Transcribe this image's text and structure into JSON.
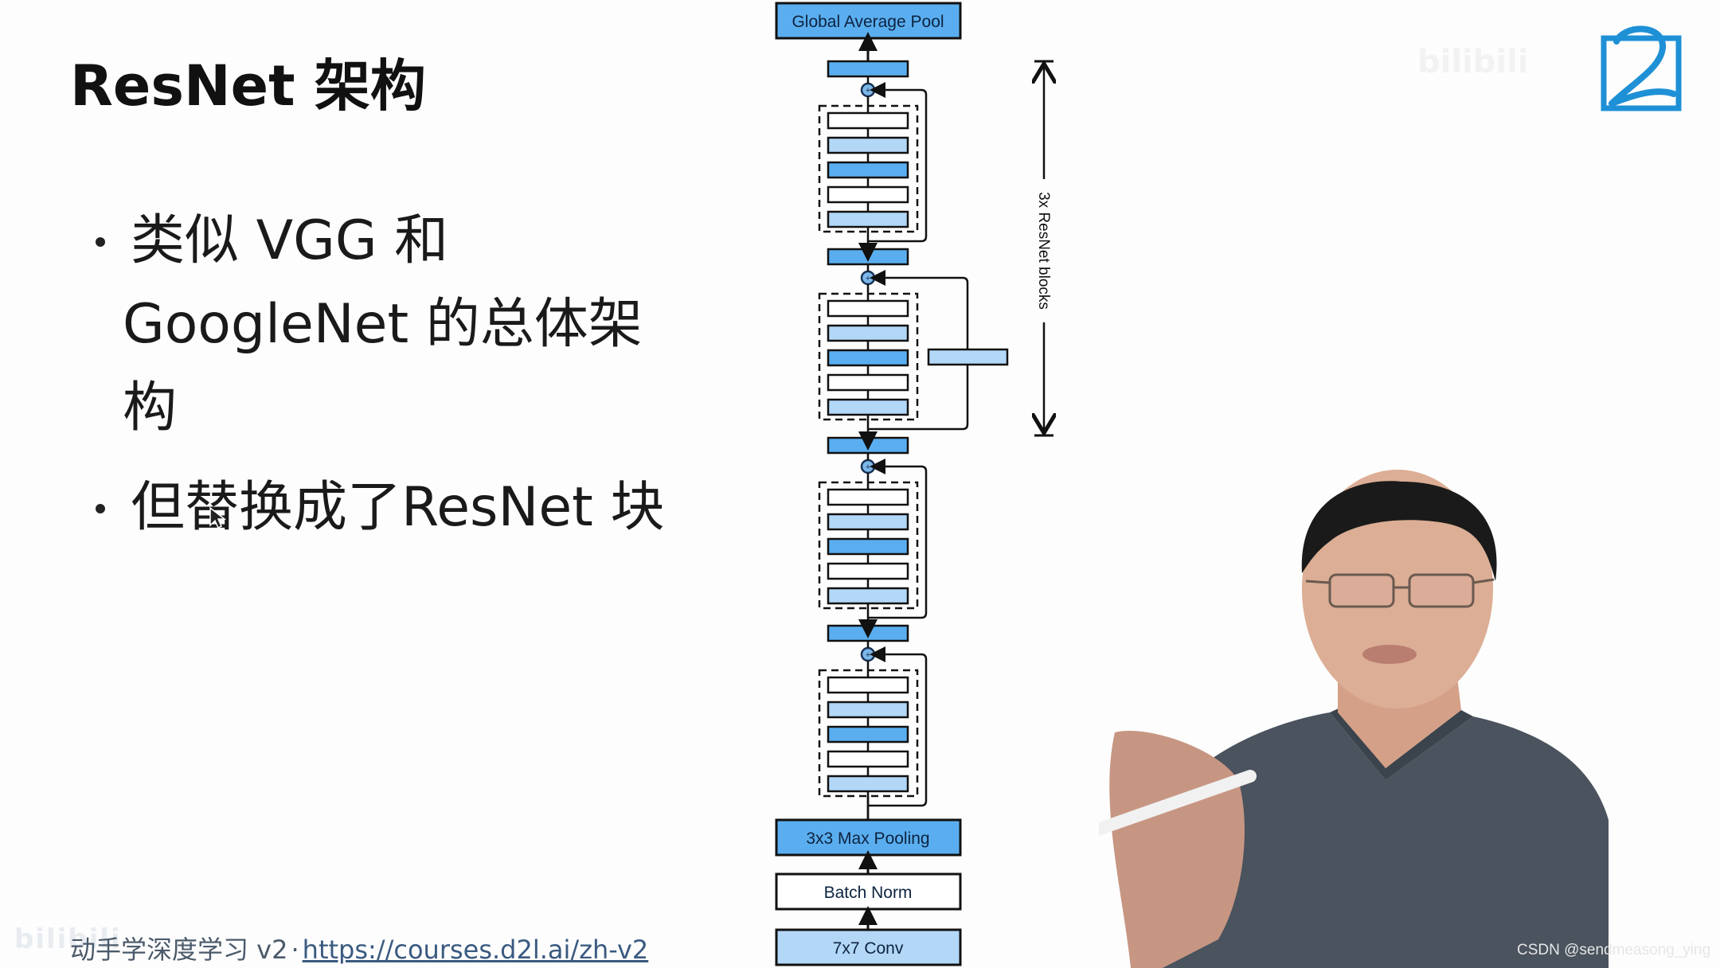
{
  "slide": {
    "title": "ResNet 架构",
    "bullets": [
      {
        "text": "类似 VGG 和 GoogleNet 的总体架构",
        "lines": [
          "类似 VGG 和",
          "GoogleNet 的总体架",
          "构"
        ]
      },
      {
        "text": "但替换成了ResNet 块",
        "lines": [
          "但替换成了ResNet 块"
        ]
      }
    ]
  },
  "footer": {
    "course": "动手学深度学习 v2",
    "separator": "·",
    "link_text": "https://courses.d2l.ai/zh-v2"
  },
  "watermarks": {
    "csdn": "CSDN @sendmeasong_ying",
    "bilibili": "bilibili"
  },
  "diagram": {
    "top_layer": "Global Average Pool",
    "bottom_layers": [
      "3x3 Max Pooling",
      "Batch Norm",
      "7x7 Conv"
    ],
    "repeat_label": "3x ResNet blocks",
    "block_count": 4,
    "projection_block_index": 1,
    "colors": {
      "dark_blue": "#5aaeef",
      "light_blue": "#b3d7f7",
      "white": "#ffffff",
      "stroke": "#111111",
      "text": "#0d2340"
    }
  },
  "logo": {
    "name": "d2l-logo",
    "color": "#1e90d6"
  },
  "presenter": {
    "shirt_color": "#4a535e",
    "skin_color": "#d9a58a",
    "hair_color": "#1a1a1a"
  }
}
